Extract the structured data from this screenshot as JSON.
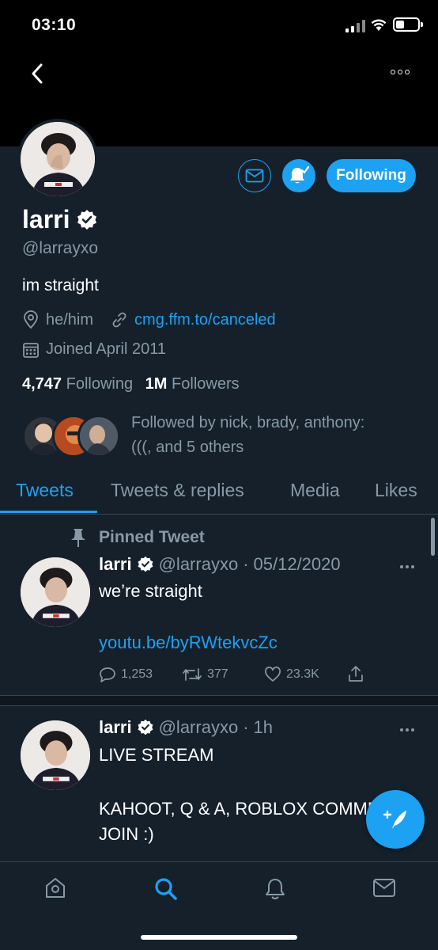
{
  "status_bar": {
    "time": "03:10"
  },
  "profile": {
    "name": "larri",
    "handle": "@larrayxo",
    "bio": "im straight",
    "pronouns": "he/him",
    "website": "cmg.ffm.to/canceled",
    "joined": "Joined April 2011",
    "following_count": "4,747",
    "following_label": "Following",
    "followers_count": "1M",
    "followers_label": "Followers",
    "followed_by_line1": "Followed by nick, brady, anthony:",
    "followed_by_line2": "(((, and 5 others",
    "follow_button": "Following"
  },
  "tabs": [
    {
      "label": "Tweets",
      "active": true
    },
    {
      "label": "Tweets & replies",
      "active": false
    },
    {
      "label": "Media",
      "active": false
    },
    {
      "label": "Likes",
      "active": false
    }
  ],
  "tweets": [
    {
      "pinned_label": "Pinned Tweet",
      "name": "larri",
      "handle": "@larrayxo",
      "sep": "·",
      "time": "05/12/2020",
      "text": "we’re straight",
      "link": "youtu.be/byRWtekvcZc",
      "replies": "1,253",
      "retweets": "377",
      "likes": "23.3K"
    },
    {
      "name": "larri",
      "handle": "@larrayxo",
      "sep": "·",
      "time": "1h",
      "line1": "LIVE STREAM",
      "line2": "KAHOOT, Q & A, ROBLOX COMMENT",
      "line3": "JOIN :)"
    }
  ],
  "icons": {
    "back": "chevron-left-icon",
    "more": "more-horizontal-icon",
    "message": "mail-icon",
    "notify": "bell-check-icon",
    "verified": "verified-badge-icon",
    "location": "location-pin-icon",
    "link": "link-icon",
    "calendar": "calendar-icon",
    "pin": "pin-icon",
    "compose": "compose-tweet-icon"
  },
  "colors": {
    "accent": "#1da1f2",
    "background": "#15202b",
    "secondary_text": "#8899a6"
  }
}
